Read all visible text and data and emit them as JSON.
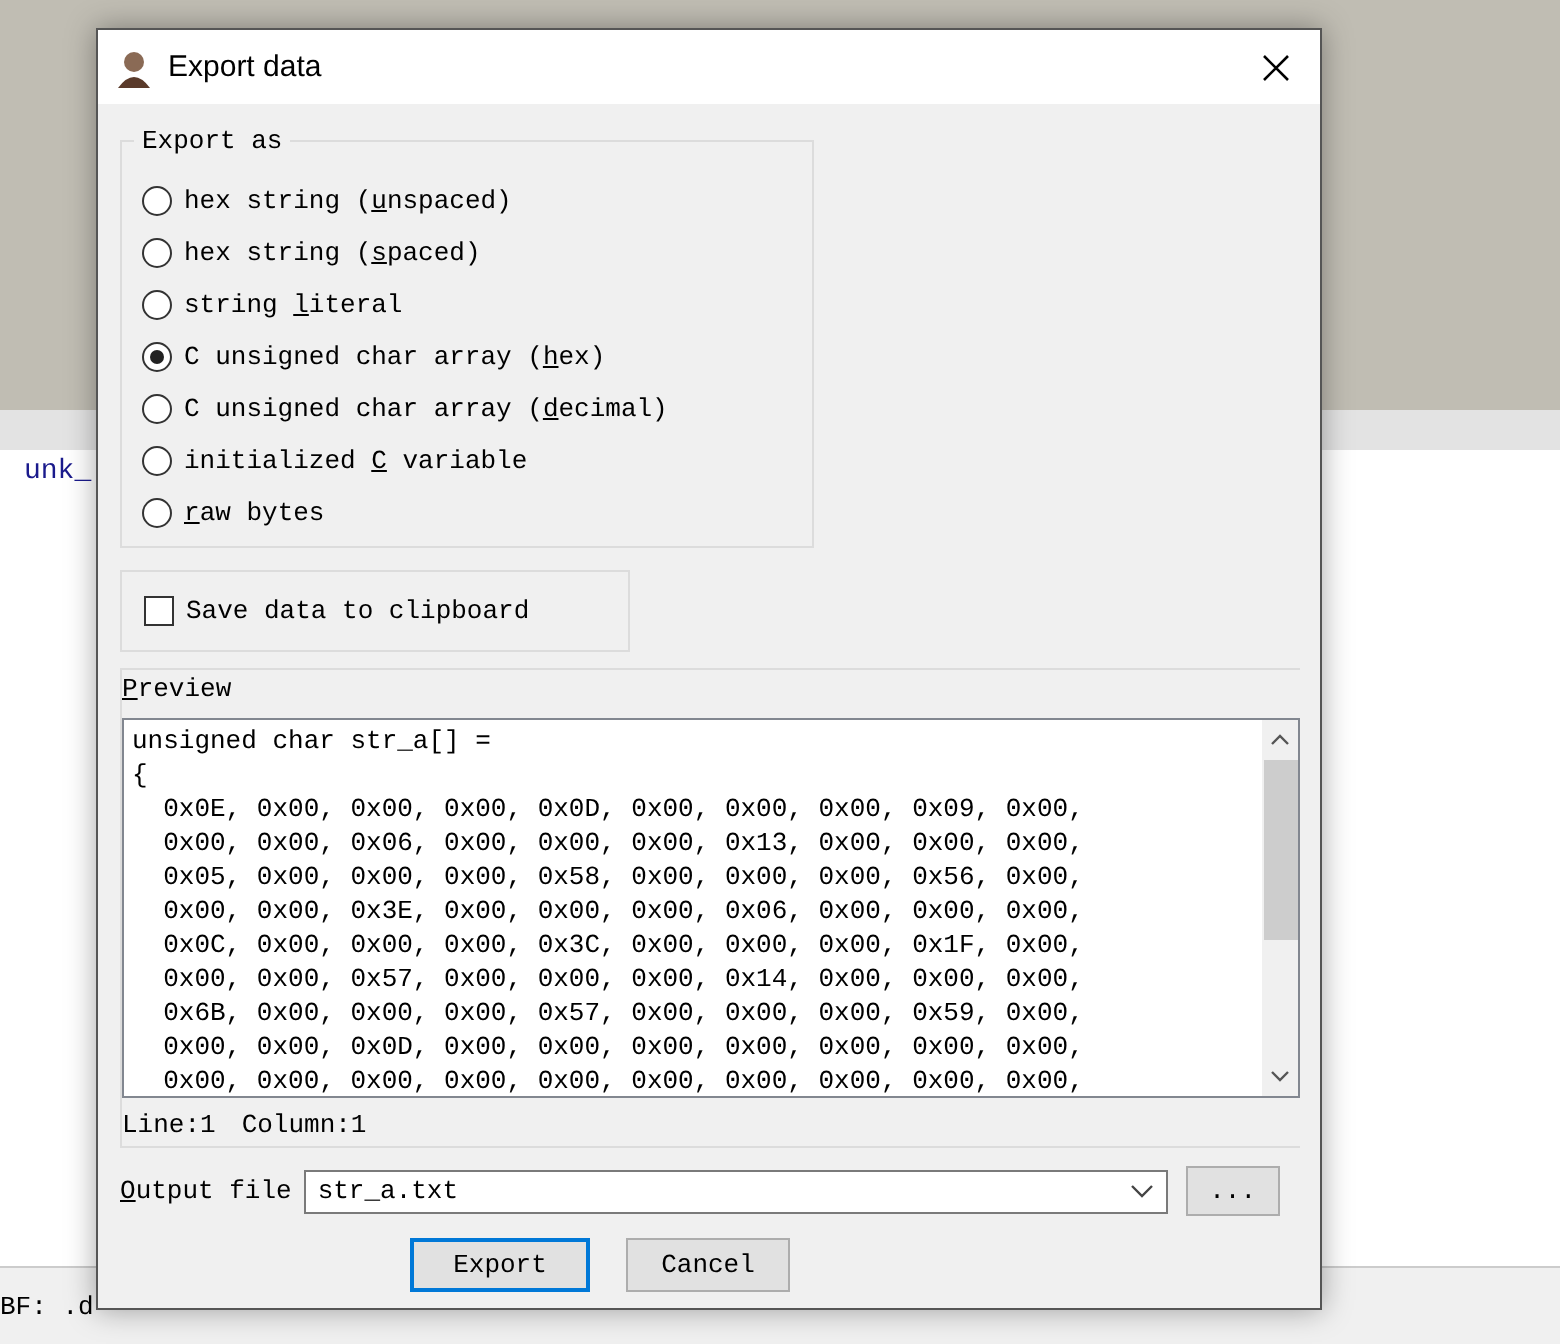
{
  "background": {
    "label": "unk_",
    "status_text": "BF: .d"
  },
  "dialog": {
    "title": "Export data",
    "export_as": {
      "title": "Export as",
      "options": [
        {
          "before": "hex string (",
          "key": "u",
          "after": "nspaced)",
          "selected": false
        },
        {
          "before": "hex string (",
          "key": "s",
          "after": "paced)",
          "selected": false
        },
        {
          "before": "string ",
          "key": "l",
          "after": "iteral",
          "selected": false
        },
        {
          "before": "C unsigned char array (",
          "key": "h",
          "after": "ex)",
          "selected": true
        },
        {
          "before": "C unsigned char array (",
          "key": "d",
          "after": "ecimal)",
          "selected": false
        },
        {
          "before": "initialized ",
          "key": "C",
          "after": " variable",
          "selected": false
        },
        {
          "key": "r",
          "after": "aw bytes",
          "selected": false
        }
      ]
    },
    "save_to_clipboard": {
      "label": "Save data to clipboard",
      "checked": false
    },
    "preview": {
      "title_key": "P",
      "title_rest": "review",
      "lines": [
        "unsigned char str_a[] =",
        "{",
        "  0x0E, 0x00, 0x00, 0x00, 0x0D, 0x00, 0x00, 0x00, 0x09, 0x00,",
        "  0x00, 0x00, 0x06, 0x00, 0x00, 0x00, 0x13, 0x00, 0x00, 0x00,",
        "  0x05, 0x00, 0x00, 0x00, 0x58, 0x00, 0x00, 0x00, 0x56, 0x00,",
        "  0x00, 0x00, 0x3E, 0x00, 0x00, 0x00, 0x06, 0x00, 0x00, 0x00,",
        "  0x0C, 0x00, 0x00, 0x00, 0x3C, 0x00, 0x00, 0x00, 0x1F, 0x00,",
        "  0x00, 0x00, 0x57, 0x00, 0x00, 0x00, 0x14, 0x00, 0x00, 0x00,",
        "  0x6B, 0x00, 0x00, 0x00, 0x57, 0x00, 0x00, 0x00, 0x59, 0x00,",
        "  0x00, 0x00, 0x0D, 0x00, 0x00, 0x00, 0x00, 0x00, 0x00, 0x00,",
        "  0x00, 0x00, 0x00, 0x00, 0x00, 0x00, 0x00, 0x00, 0x00, 0x00,"
      ],
      "line": "Line:1",
      "column": "Column:1"
    },
    "output_file": {
      "label_key": "O",
      "label_rest": "utput file",
      "value": "str_a.txt"
    },
    "browse_button": "...",
    "buttons": [
      {
        "label": "Export",
        "default": true
      },
      {
        "label": "Cancel",
        "default": false
      }
    ]
  }
}
